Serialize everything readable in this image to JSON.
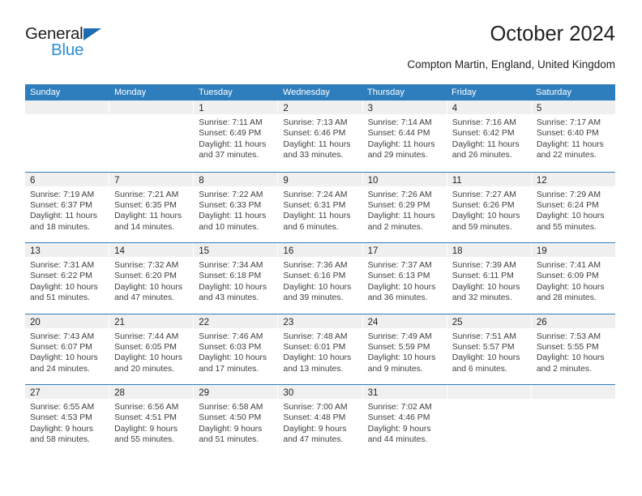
{
  "brand": {
    "name_part1": "General",
    "name_part2": "Blue",
    "triangle_color": "#1b6cb0",
    "blue_color": "#2b8fd6"
  },
  "header": {
    "title": "October 2024",
    "subtitle": "Compton Martin, England, United Kingdom",
    "accent_color": "#2e7ebd",
    "daynum_band_color": "#f0f0f0"
  },
  "weekdays": [
    "Sunday",
    "Monday",
    "Tuesday",
    "Wednesday",
    "Thursday",
    "Friday",
    "Saturday"
  ],
  "weeks": [
    {
      "cells": [
        {
          "day": "",
          "empty": true,
          "sunrise": "",
          "sunset": "",
          "daylight_line1": "",
          "daylight_line2": ""
        },
        {
          "day": "",
          "empty": true,
          "sunrise": "",
          "sunset": "",
          "daylight_line1": "",
          "daylight_line2": ""
        },
        {
          "day": "1",
          "empty": false,
          "sunrise": "Sunrise: 7:11 AM",
          "sunset": "Sunset: 6:49 PM",
          "daylight_line1": "Daylight: 11 hours",
          "daylight_line2": "and 37 minutes."
        },
        {
          "day": "2",
          "empty": false,
          "sunrise": "Sunrise: 7:13 AM",
          "sunset": "Sunset: 6:46 PM",
          "daylight_line1": "Daylight: 11 hours",
          "daylight_line2": "and 33 minutes."
        },
        {
          "day": "3",
          "empty": false,
          "sunrise": "Sunrise: 7:14 AM",
          "sunset": "Sunset: 6:44 PM",
          "daylight_line1": "Daylight: 11 hours",
          "daylight_line2": "and 29 minutes."
        },
        {
          "day": "4",
          "empty": false,
          "sunrise": "Sunrise: 7:16 AM",
          "sunset": "Sunset: 6:42 PM",
          "daylight_line1": "Daylight: 11 hours",
          "daylight_line2": "and 26 minutes."
        },
        {
          "day": "5",
          "empty": false,
          "sunrise": "Sunrise: 7:17 AM",
          "sunset": "Sunset: 6:40 PM",
          "daylight_line1": "Daylight: 11 hours",
          "daylight_line2": "and 22 minutes."
        }
      ]
    },
    {
      "cells": [
        {
          "day": "6",
          "empty": false,
          "sunrise": "Sunrise: 7:19 AM",
          "sunset": "Sunset: 6:37 PM",
          "daylight_line1": "Daylight: 11 hours",
          "daylight_line2": "and 18 minutes."
        },
        {
          "day": "7",
          "empty": false,
          "sunrise": "Sunrise: 7:21 AM",
          "sunset": "Sunset: 6:35 PM",
          "daylight_line1": "Daylight: 11 hours",
          "daylight_line2": "and 14 minutes."
        },
        {
          "day": "8",
          "empty": false,
          "sunrise": "Sunrise: 7:22 AM",
          "sunset": "Sunset: 6:33 PM",
          "daylight_line1": "Daylight: 11 hours",
          "daylight_line2": "and 10 minutes."
        },
        {
          "day": "9",
          "empty": false,
          "sunrise": "Sunrise: 7:24 AM",
          "sunset": "Sunset: 6:31 PM",
          "daylight_line1": "Daylight: 11 hours",
          "daylight_line2": "and 6 minutes."
        },
        {
          "day": "10",
          "empty": false,
          "sunrise": "Sunrise: 7:26 AM",
          "sunset": "Sunset: 6:29 PM",
          "daylight_line1": "Daylight: 11 hours",
          "daylight_line2": "and 2 minutes."
        },
        {
          "day": "11",
          "empty": false,
          "sunrise": "Sunrise: 7:27 AM",
          "sunset": "Sunset: 6:26 PM",
          "daylight_line1": "Daylight: 10 hours",
          "daylight_line2": "and 59 minutes."
        },
        {
          "day": "12",
          "empty": false,
          "sunrise": "Sunrise: 7:29 AM",
          "sunset": "Sunset: 6:24 PM",
          "daylight_line1": "Daylight: 10 hours",
          "daylight_line2": "and 55 minutes."
        }
      ]
    },
    {
      "cells": [
        {
          "day": "13",
          "empty": false,
          "sunrise": "Sunrise: 7:31 AM",
          "sunset": "Sunset: 6:22 PM",
          "daylight_line1": "Daylight: 10 hours",
          "daylight_line2": "and 51 minutes."
        },
        {
          "day": "14",
          "empty": false,
          "sunrise": "Sunrise: 7:32 AM",
          "sunset": "Sunset: 6:20 PM",
          "daylight_line1": "Daylight: 10 hours",
          "daylight_line2": "and 47 minutes."
        },
        {
          "day": "15",
          "empty": false,
          "sunrise": "Sunrise: 7:34 AM",
          "sunset": "Sunset: 6:18 PM",
          "daylight_line1": "Daylight: 10 hours",
          "daylight_line2": "and 43 minutes."
        },
        {
          "day": "16",
          "empty": false,
          "sunrise": "Sunrise: 7:36 AM",
          "sunset": "Sunset: 6:16 PM",
          "daylight_line1": "Daylight: 10 hours",
          "daylight_line2": "and 39 minutes."
        },
        {
          "day": "17",
          "empty": false,
          "sunrise": "Sunrise: 7:37 AM",
          "sunset": "Sunset: 6:13 PM",
          "daylight_line1": "Daylight: 10 hours",
          "daylight_line2": "and 36 minutes."
        },
        {
          "day": "18",
          "empty": false,
          "sunrise": "Sunrise: 7:39 AM",
          "sunset": "Sunset: 6:11 PM",
          "daylight_line1": "Daylight: 10 hours",
          "daylight_line2": "and 32 minutes."
        },
        {
          "day": "19",
          "empty": false,
          "sunrise": "Sunrise: 7:41 AM",
          "sunset": "Sunset: 6:09 PM",
          "daylight_line1": "Daylight: 10 hours",
          "daylight_line2": "and 28 minutes."
        }
      ]
    },
    {
      "cells": [
        {
          "day": "20",
          "empty": false,
          "sunrise": "Sunrise: 7:43 AM",
          "sunset": "Sunset: 6:07 PM",
          "daylight_line1": "Daylight: 10 hours",
          "daylight_line2": "and 24 minutes."
        },
        {
          "day": "21",
          "empty": false,
          "sunrise": "Sunrise: 7:44 AM",
          "sunset": "Sunset: 6:05 PM",
          "daylight_line1": "Daylight: 10 hours",
          "daylight_line2": "and 20 minutes."
        },
        {
          "day": "22",
          "empty": false,
          "sunrise": "Sunrise: 7:46 AM",
          "sunset": "Sunset: 6:03 PM",
          "daylight_line1": "Daylight: 10 hours",
          "daylight_line2": "and 17 minutes."
        },
        {
          "day": "23",
          "empty": false,
          "sunrise": "Sunrise: 7:48 AM",
          "sunset": "Sunset: 6:01 PM",
          "daylight_line1": "Daylight: 10 hours",
          "daylight_line2": "and 13 minutes."
        },
        {
          "day": "24",
          "empty": false,
          "sunrise": "Sunrise: 7:49 AM",
          "sunset": "Sunset: 5:59 PM",
          "daylight_line1": "Daylight: 10 hours",
          "daylight_line2": "and 9 minutes."
        },
        {
          "day": "25",
          "empty": false,
          "sunrise": "Sunrise: 7:51 AM",
          "sunset": "Sunset: 5:57 PM",
          "daylight_line1": "Daylight: 10 hours",
          "daylight_line2": "and 6 minutes."
        },
        {
          "day": "26",
          "empty": false,
          "sunrise": "Sunrise: 7:53 AM",
          "sunset": "Sunset: 5:55 PM",
          "daylight_line1": "Daylight: 10 hours",
          "daylight_line2": "and 2 minutes."
        }
      ]
    },
    {
      "cells": [
        {
          "day": "27",
          "empty": false,
          "sunrise": "Sunrise: 6:55 AM",
          "sunset": "Sunset: 4:53 PM",
          "daylight_line1": "Daylight: 9 hours",
          "daylight_line2": "and 58 minutes."
        },
        {
          "day": "28",
          "empty": false,
          "sunrise": "Sunrise: 6:56 AM",
          "sunset": "Sunset: 4:51 PM",
          "daylight_line1": "Daylight: 9 hours",
          "daylight_line2": "and 55 minutes."
        },
        {
          "day": "29",
          "empty": false,
          "sunrise": "Sunrise: 6:58 AM",
          "sunset": "Sunset: 4:50 PM",
          "daylight_line1": "Daylight: 9 hours",
          "daylight_line2": "and 51 minutes."
        },
        {
          "day": "30",
          "empty": false,
          "sunrise": "Sunrise: 7:00 AM",
          "sunset": "Sunset: 4:48 PM",
          "daylight_line1": "Daylight: 9 hours",
          "daylight_line2": "and 47 minutes."
        },
        {
          "day": "31",
          "empty": false,
          "sunrise": "Sunrise: 7:02 AM",
          "sunset": "Sunset: 4:46 PM",
          "daylight_line1": "Daylight: 9 hours",
          "daylight_line2": "and 44 minutes."
        },
        {
          "day": "",
          "empty": true,
          "sunrise": "",
          "sunset": "",
          "daylight_line1": "",
          "daylight_line2": ""
        },
        {
          "day": "",
          "empty": true,
          "sunrise": "",
          "sunset": "",
          "daylight_line1": "",
          "daylight_line2": ""
        }
      ]
    }
  ]
}
